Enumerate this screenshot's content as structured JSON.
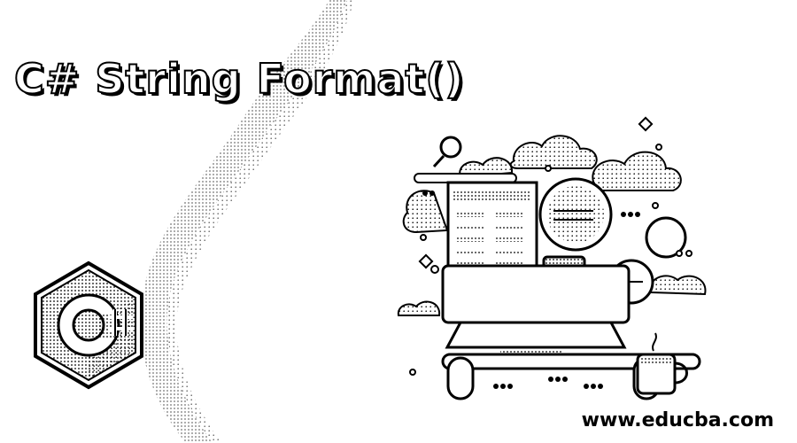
{
  "page": {
    "title": "C# String Format()",
    "website": "www.educba.com",
    "logo_text": "C#"
  },
  "colors": {
    "ink": "#000000",
    "paper": "#ffffff",
    "stipple": "#8a8a8a"
  },
  "icons": [
    "csharp-logo",
    "search-icon",
    "browser-window",
    "speech-bubble",
    "laptop",
    "coffee-mug",
    "cloud",
    "sparkle"
  ]
}
